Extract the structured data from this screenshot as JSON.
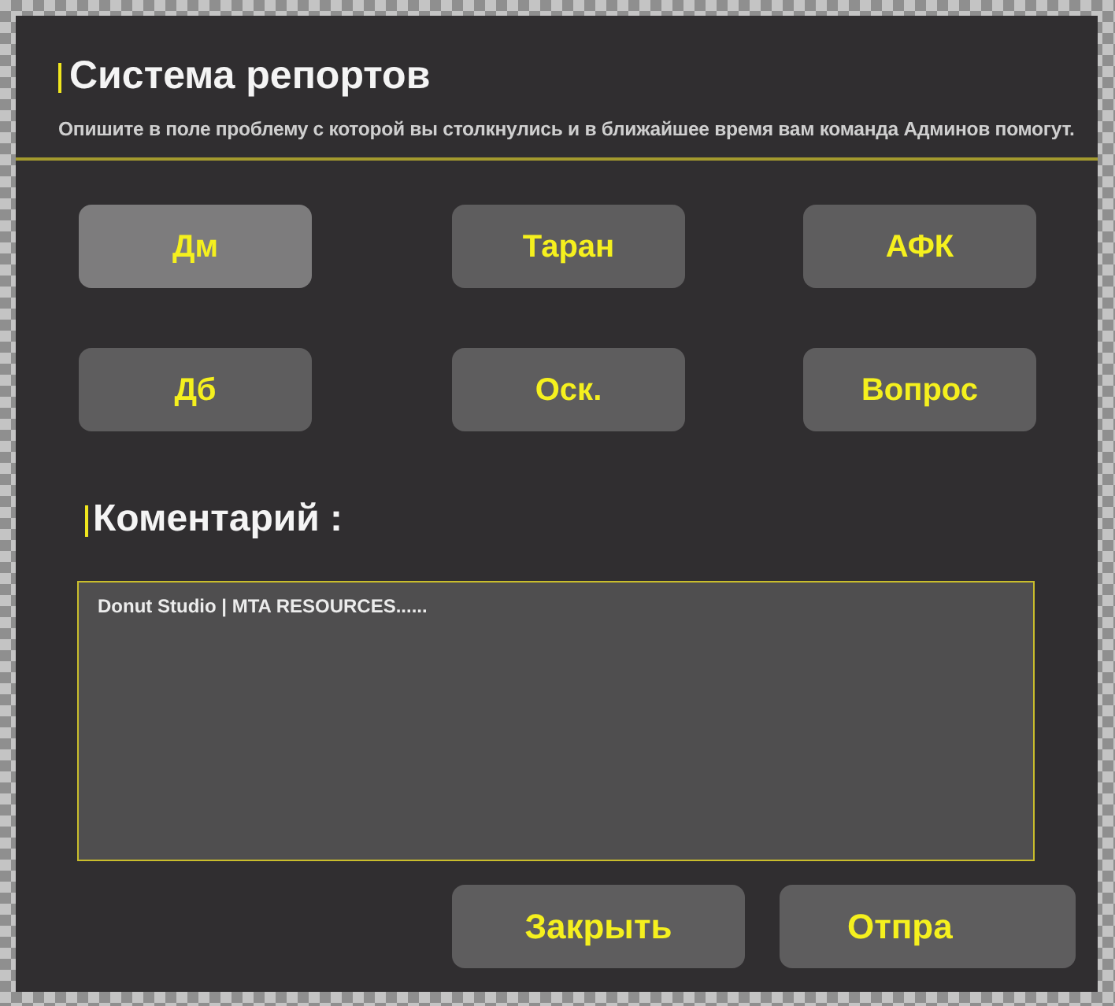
{
  "window": {
    "title": "Система репортов",
    "subtitle": "Опишите в поле проблему с которой вы столкнулись и в ближайшее время вам команда Админов помогут."
  },
  "report_types": [
    {
      "label": "Дм",
      "selected": true
    },
    {
      "label": "Таран",
      "selected": false
    },
    {
      "label": "АФК",
      "selected": false
    },
    {
      "label": "Дб",
      "selected": false
    },
    {
      "label": "Оск.",
      "selected": false
    },
    {
      "label": "Вопрос",
      "selected": false
    }
  ],
  "comment": {
    "label": "Коментарий :",
    "value": "Donut Studio | MTA RESOURCES......"
  },
  "buttons": [
    {
      "label": "Закрыть"
    },
    {
      "label": "Отпра"
    }
  ]
}
